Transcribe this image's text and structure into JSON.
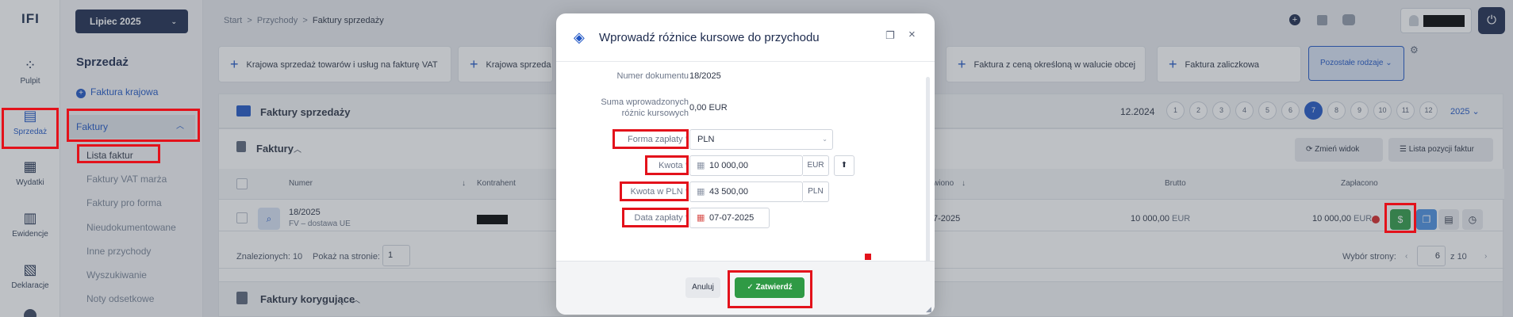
{
  "rail": {
    "logo": "IFI",
    "items": [
      {
        "label": "Pulpit",
        "icon": "dashboard-icon"
      },
      {
        "label": "Sprzedaż",
        "icon": "invoice-icon"
      },
      {
        "label": "Wydatki",
        "icon": "receipt-icon"
      },
      {
        "label": "Ewidencje",
        "icon": "clipboard-icon"
      },
      {
        "label": "Deklaracje",
        "icon": "document-icon"
      }
    ]
  },
  "sidebar": {
    "month": "Lipiec 2025",
    "heading": "Sprzedaż",
    "add_label": "Faktura krajowa",
    "group_label": "Faktury",
    "items": [
      "Lista faktur",
      "Faktury VAT marża",
      "Faktury pro forma",
      "Nieudokumentowane",
      "Inne przychody",
      "Wyszukiwanie",
      "Noty odsetkowe"
    ]
  },
  "breadcrumb": {
    "home": "Start",
    "section": "Przychody",
    "current": "Faktury sprzedaży"
  },
  "toolbar": {
    "btn1": "Krajowa sprzedaż towarów i usług na fakturę VAT",
    "btn2": "Krajowa sprzeda",
    "btn3": "Faktura z ceną określoną w walucie obcej",
    "btn4": "Faktura zaliczkowa",
    "btn5": "Pozostałe rodzaje"
  },
  "sales": {
    "title": "Faktury sprzedaży",
    "period": "12.2024",
    "pages": [
      "1",
      "2",
      "3",
      "4",
      "5",
      "6",
      "7",
      "8",
      "9",
      "10",
      "11",
      "12"
    ],
    "active_page": "7",
    "year": "2025"
  },
  "list": {
    "title": "Faktury",
    "change_view": "Zmień widok",
    "positions_list": "Lista pozycji faktur",
    "columns": {
      "number": "Numer",
      "contractor": "Kontrahent",
      "issued": "wiono",
      "gross": "Brutto",
      "paid": "Zapłacono"
    },
    "row": {
      "number": "18/2025",
      "type": "FV – dostawa UE",
      "date": "7-2025",
      "gross_value": "10 000,00",
      "gross_currency": "EUR",
      "paid_value": "10 000,00",
      "paid_currency": "EUR"
    },
    "found_label": "Znalezionych:",
    "found_count": "10",
    "per_page_label": "Pokaż na stronie:",
    "per_page_value": "1",
    "page_select_label": "Wybór strony:",
    "page_current": "6",
    "page_of": "z",
    "page_total": "10"
  },
  "corrections": {
    "title": "Faktury korygujące"
  },
  "modal": {
    "title": "Wprowadź różnice kursowe do przychodu",
    "doc_label": "Numer dokumentu",
    "doc_value": "18/2025",
    "sum_label_1": "Suma wprowadzonych",
    "sum_label_2": "różnic kursowych",
    "sum_value": "0,00 EUR",
    "payment_label": "Forma zapłaty *",
    "payment_value": "PLN",
    "amount_label": "Kwota *",
    "amount_value": "10 000,00",
    "amount_unit": "EUR",
    "amount_pln_label": "Kwota w PLN *",
    "amount_pln_value": "43 500,00",
    "amount_pln_unit": "PLN",
    "date_label": "Data zapłaty *",
    "date_value": "07-07-2025",
    "cancel": "Anuluj",
    "confirm": "Zatwierdź"
  },
  "colors": {
    "accent": "#1f55c4",
    "highlight": "#e3121b",
    "confirm": "#2f9a45"
  }
}
